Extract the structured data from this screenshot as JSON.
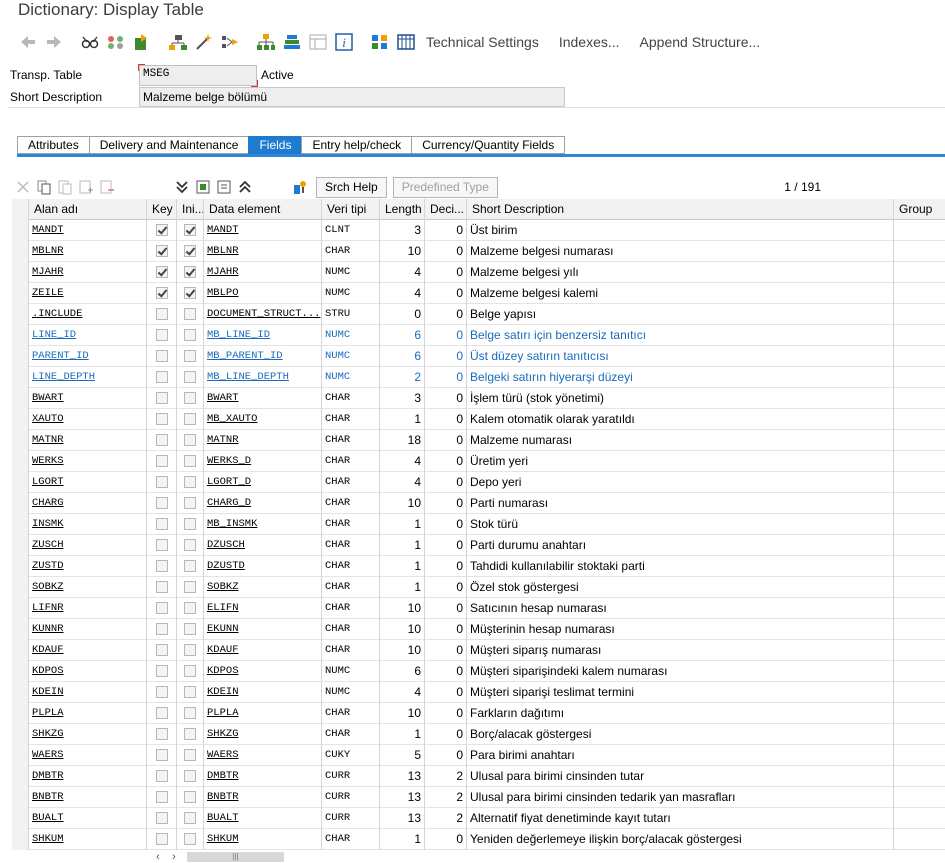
{
  "window": {
    "title": "Dictionary: Display Table"
  },
  "toolbar": {
    "icons": [
      "back-icon",
      "forward-icon",
      "glasses-icon",
      "object-list-icon",
      "where-used-icon",
      "hierarchy-icon",
      "magic-wand-icon",
      "navigate-icon",
      "tree-icon",
      "stack-icon",
      "layout-icon",
      "info-icon",
      "grid-icon",
      "table-icon"
    ],
    "technical_settings": "Technical Settings",
    "indexes": "Indexes...",
    "append_structure": "Append Structure..."
  },
  "header": {
    "table_label": "Transp. Table",
    "table_value": "MSEG",
    "status": "Active",
    "desc_label": "Short Description",
    "desc_value": "Malzeme belge bölümü"
  },
  "tabs": [
    "Attributes",
    "Delivery and Maintenance",
    "Fields",
    "Entry help/check",
    "Currency/Quantity Fields"
  ],
  "active_tab": 2,
  "grid_toolbar": {
    "srch_help": "Srch Help",
    "predefined_type": "Predefined Type",
    "pager": "1 / 191"
  },
  "columns": [
    "Alan adı",
    "Key",
    "Ini...",
    "Data element",
    "Veri tipi",
    "Length",
    "Deci...",
    "Short Description",
    "Group"
  ],
  "rows": [
    {
      "field": "MANDT",
      "key": true,
      "ini": true,
      "de": "MANDT",
      "type": "CLNT",
      "len": "3",
      "dec": "0",
      "desc": "Üst birim",
      "blue": false,
      "mono": true
    },
    {
      "field": "MBLNR",
      "key": true,
      "ini": true,
      "de": "MBLNR",
      "type": "CHAR",
      "len": "10",
      "dec": "0",
      "desc": "Malzeme belgesi numarası",
      "blue": false,
      "mono": true
    },
    {
      "field": "MJAHR",
      "key": true,
      "ini": true,
      "de": "MJAHR",
      "type": "NUMC",
      "len": "4",
      "dec": "0",
      "desc": "Malzeme belgesi yılı",
      "blue": false,
      "mono": true
    },
    {
      "field": "ZEILE",
      "key": true,
      "ini": true,
      "de": "MBLPO",
      "type": "NUMC",
      "len": "4",
      "dec": "0",
      "desc": "Malzeme belgesi kalemi",
      "blue": false,
      "mono": true
    },
    {
      "field": ".INCLUDE",
      "key": false,
      "ini": false,
      "de": "DOCUMENT_STRUCT...",
      "type": "STRU",
      "len": "0",
      "dec": "0",
      "desc": "Belge yapısı",
      "blue": false,
      "mono": true
    },
    {
      "field": "LINE_ID",
      "key": false,
      "ini": false,
      "de": "MB_LINE_ID",
      "type": "NUMC",
      "len": "6",
      "dec": "0",
      "desc": "Belge satırı için benzersiz tanıtıcı",
      "blue": true,
      "mono": true
    },
    {
      "field": "PARENT_ID",
      "key": false,
      "ini": false,
      "de": "MB_PARENT_ID",
      "type": "NUMC",
      "len": "6",
      "dec": "0",
      "desc": "Üst düzey satırın tanıtıcısı",
      "blue": true,
      "mono": true
    },
    {
      "field": "LINE_DEPTH",
      "key": false,
      "ini": false,
      "de": "MB_LINE_DEPTH",
      "type": "NUMC",
      "len": "2",
      "dec": "0",
      "desc": "Belgeki satırın hiyerarşi düzeyi",
      "blue": true,
      "mono": true
    },
    {
      "field": "BWART",
      "key": false,
      "ini": false,
      "de": "BWART",
      "type": "CHAR",
      "len": "3",
      "dec": "0",
      "desc": "İşlem türü (stok yönetimi)",
      "blue": false,
      "mono": true
    },
    {
      "field": "XAUTO",
      "key": false,
      "ini": false,
      "de": "MB_XAUTO",
      "type": "CHAR",
      "len": "1",
      "dec": "0",
      "desc": "Kalem otomatik olarak yaratıldı",
      "blue": false,
      "mono": true
    },
    {
      "field": "MATNR",
      "key": false,
      "ini": false,
      "de": "MATNR",
      "type": "CHAR",
      "len": "18",
      "dec": "0",
      "desc": "Malzeme numarası",
      "blue": false,
      "mono": true
    },
    {
      "field": "WERKS",
      "key": false,
      "ini": false,
      "de": "WERKS_D",
      "type": "CHAR",
      "len": "4",
      "dec": "0",
      "desc": "Üretim yeri",
      "blue": false,
      "mono": true
    },
    {
      "field": "LGORT",
      "key": false,
      "ini": false,
      "de": "LGORT_D",
      "type": "CHAR",
      "len": "4",
      "dec": "0",
      "desc": "Depo yeri",
      "blue": false,
      "mono": true
    },
    {
      "field": "CHARG",
      "key": false,
      "ini": false,
      "de": "CHARG_D",
      "type": "CHAR",
      "len": "10",
      "dec": "0",
      "desc": "Parti numarası",
      "blue": false,
      "mono": true
    },
    {
      "field": "INSMK",
      "key": false,
      "ini": false,
      "de": "MB_INSMK",
      "type": "CHAR",
      "len": "1",
      "dec": "0",
      "desc": "Stok türü",
      "blue": false,
      "mono": true
    },
    {
      "field": "ZUSCH",
      "key": false,
      "ini": false,
      "de": "DZUSCH",
      "type": "CHAR",
      "len": "1",
      "dec": "0",
      "desc": "Parti durumu anahtarı",
      "blue": false,
      "mono": true
    },
    {
      "field": "ZUSTD",
      "key": false,
      "ini": false,
      "de": "DZUSTD",
      "type": "CHAR",
      "len": "1",
      "dec": "0",
      "desc": "Tahdidi kullanılabilir stoktaki parti",
      "blue": false,
      "mono": true
    },
    {
      "field": "SOBKZ",
      "key": false,
      "ini": false,
      "de": "SOBKZ",
      "type": "CHAR",
      "len": "1",
      "dec": "0",
      "desc": "Özel stok göstergesi",
      "blue": false,
      "mono": true
    },
    {
      "field": "LIFNR",
      "key": false,
      "ini": false,
      "de": "ELIFN",
      "type": "CHAR",
      "len": "10",
      "dec": "0",
      "desc": "Satıcının hesap numarası",
      "blue": false,
      "mono": true
    },
    {
      "field": "KUNNR",
      "key": false,
      "ini": false,
      "de": "EKUNN",
      "type": "CHAR",
      "len": "10",
      "dec": "0",
      "desc": "Müşterinin hesap numarası",
      "blue": false,
      "mono": true
    },
    {
      "field": "KDAUF",
      "key": false,
      "ini": false,
      "de": "KDAUF",
      "type": "CHAR",
      "len": "10",
      "dec": "0",
      "desc": "Müşteri siparış numarası",
      "blue": false,
      "mono": true
    },
    {
      "field": "KDPOS",
      "key": false,
      "ini": false,
      "de": "KDPOS",
      "type": "NUMC",
      "len": "6",
      "dec": "0",
      "desc": "Müşteri siparişindeki kalem numarası",
      "blue": false,
      "mono": true
    },
    {
      "field": "KDEIN",
      "key": false,
      "ini": false,
      "de": "KDEIN",
      "type": "NUMC",
      "len": "4",
      "dec": "0",
      "desc": "Müşteri siparişi teslimat termini",
      "blue": false,
      "mono": true
    },
    {
      "field": "PLPLA",
      "key": false,
      "ini": false,
      "de": "PLPLA",
      "type": "CHAR",
      "len": "10",
      "dec": "0",
      "desc": "Farkların dağıtımı",
      "blue": false,
      "mono": true
    },
    {
      "field": "SHKZG",
      "key": false,
      "ini": false,
      "de": "SHKZG",
      "type": "CHAR",
      "len": "1",
      "dec": "0",
      "desc": "Borç/alacak göstergesi",
      "blue": false,
      "mono": true
    },
    {
      "field": "WAERS",
      "key": false,
      "ini": false,
      "de": "WAERS",
      "type": "CUKY",
      "len": "5",
      "dec": "0",
      "desc": "Para birimi anahtarı",
      "blue": false,
      "mono": true
    },
    {
      "field": "DMBTR",
      "key": false,
      "ini": false,
      "de": "DMBTR",
      "type": "CURR",
      "len": "13",
      "dec": "2",
      "desc": "Ulusal para birimi cinsinden tutar",
      "blue": false,
      "mono": true
    },
    {
      "field": "BNBTR",
      "key": false,
      "ini": false,
      "de": "BNBTR",
      "type": "CURR",
      "len": "13",
      "dec": "2",
      "desc": "Ulusal para birimi cinsinden tedarik yan masrafları",
      "blue": false,
      "mono": true
    },
    {
      "field": "BUALT",
      "key": false,
      "ini": false,
      "de": "BUALT",
      "type": "CURR",
      "len": "13",
      "dec": "2",
      "desc": "Alternatif fiyat denetiminde kayıt tutarı",
      "blue": false,
      "mono": true
    },
    {
      "field": "SHKUM",
      "key": false,
      "ini": false,
      "de": "SHKUM",
      "type": "CHAR",
      "len": "1",
      "dec": "0",
      "desc": "Yeniden değerlemeye ilişkin borç/alacak göstergesi",
      "blue": false,
      "mono": true
    }
  ],
  "colors": {
    "accent": "#1f7bd1",
    "link_blue": "#1a6bbd"
  }
}
